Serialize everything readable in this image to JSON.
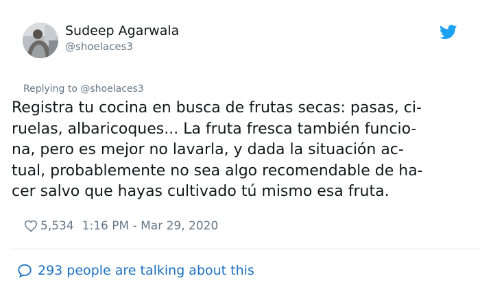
{
  "author": {
    "display_name": "Sudeep Agarwala",
    "handle": "@shoelaces3",
    "avatar_icon": "profile-photo"
  },
  "reply_context": "Replying to @shoelaces3",
  "tweet": {
    "lines": [
      "Registra tu cocina en busca de frutas secas: pasas, ci-",
      "ruelas, albaricoques... La fruta fresca también funcio-",
      "na, pero es mejor no lavarla, y dada la situación ac-",
      "tual, probablemente no sea algo recomendable de ha-",
      "cer salvo que hayas cultivado tú mismo esa fruta."
    ]
  },
  "meta": {
    "likes": "5,534",
    "timestamp": "1:16 PM - Mar 29, 2020"
  },
  "conversation": {
    "label": "293 people are talking about this"
  },
  "colors": {
    "twitter_blue": "#1da1f2",
    "link_blue": "#1b6fc0",
    "muted_gray": "#657786",
    "text": "#14171a",
    "divider": "#e1e8ed"
  }
}
